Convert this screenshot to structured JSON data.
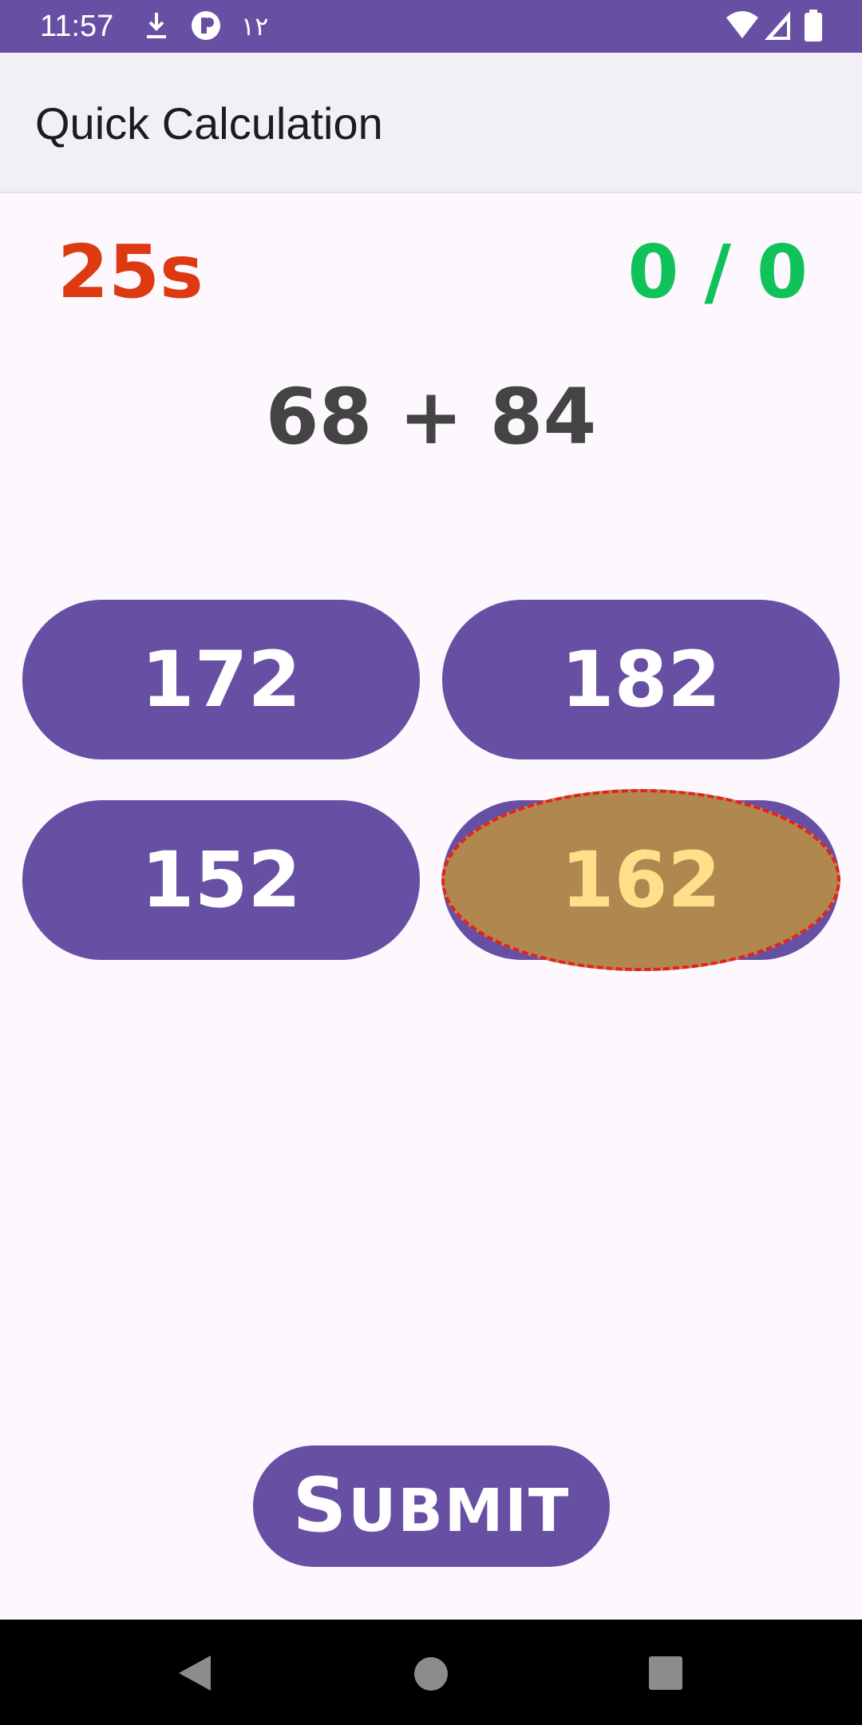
{
  "status_bar": {
    "time": "11:57",
    "arabic_digits": "١٢",
    "icons": [
      "download-icon",
      "app-notification-icon",
      "wifi-icon",
      "signal-icon",
      "battery-icon"
    ]
  },
  "app_bar": {
    "title": "Quick Calculation"
  },
  "game": {
    "timer": "25s",
    "score": "0 / 0",
    "question": "68 + 84",
    "answers": [
      "172",
      "182",
      "152",
      "162"
    ],
    "selected_answer": "162",
    "submit_first": "S",
    "submit_rest": "UBMIT"
  },
  "navigation": {
    "icons": [
      "back-icon",
      "home-icon",
      "recents-icon"
    ]
  },
  "colors": {
    "primary": "#6750A4",
    "timer": "#DE3A12",
    "score": "#0FC35A",
    "selected_fill": "#B0874F",
    "selected_text": "#FFE08A",
    "selected_outline": "#E8201C"
  }
}
